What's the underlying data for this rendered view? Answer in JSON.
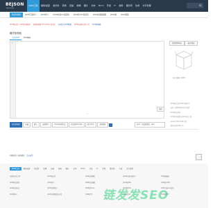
{
  "brand": {
    "name": "BEJSON",
    "tagline": "bejson.com"
  },
  "nav": {
    "items": [
      "JSON工具",
      "编码/加密",
      "格式化",
      "转换",
      "压缩",
      "前端",
      "图片",
      "文本",
      "Mock",
      "开发",
      "IT",
      "常用",
      "图片转",
      "生成",
      "文字处理"
    ],
    "active_index": 0
  },
  "tool_tabs": [
    "格式化校验",
    "JSON压缩转义",
    "JSON转义",
    "JSON在线uni组装格",
    "JSON转CSV格式化",
    "JSON在线图视图",
    "JSON格",
    "JSON模板"
  ],
  "tool_tabs_active": 0,
  "page_title": "格式化校验",
  "notices": [
    {
      "text": "JSON格式化 / JSON在线校验",
      "color": "red"
    },
    {
      "text": "使用快捷键 Ctrl+Enter 格式化",
      "color": "red"
    },
    {
      "text": "支持超大JSON数据",
      "color": "blue"
    },
    {
      "text": "JSON在线格式化工具",
      "color": "red"
    },
    {
      "text": "JSON编辑器",
      "color": "blue"
    }
  ],
  "sub_tabs": [
    "中文JSON",
    "JSON解析"
  ],
  "sub_tabs_active": 0,
  "editor": {
    "line_number": "1",
    "drag_hint": "≡",
    "save_label": "保存"
  },
  "side_buttons": [
    "复制代码地址",
    "展开/收起"
  ],
  "empty_text": "在左边输入JSON",
  "bullets": [
    "• JSON格式化/JSON压缩/转义",
    "• 支持一键JSON格式化与校验",
    "• JSON转实体类",
    "• JSON在线转换与JSON对比工具",
    "• JSON与XML/YAML互转",
    "• 更多在线JSON工具"
  ],
  "toolbar": {
    "buttons": [
      "格式化校验",
      "压缩",
      "转义",
      "去除转义",
      "Unicode转中文",
      "中文转Unicode",
      "转义引号",
      "字段排序"
    ],
    "primary_index": 0,
    "lang_select": "Java - 生成实体类 - Java"
  },
  "ask": {
    "prefix": "问题反馈 / 意见建议：",
    "link": "点击这里"
  },
  "footer": {
    "tabs": [
      "JSON工具",
      "编码加密",
      "格式化",
      "转换",
      "压缩",
      "前端",
      "图片",
      "文本",
      "Mock",
      "开发",
      "IT",
      "常用",
      "图片转",
      "生成",
      "文字处理"
    ],
    "active_index": 0,
    "links": [
      "在线格式化工具",
      "JSON格式化",
      "JSON在线解析",
      "JSON在线压缩转义",
      "JSON编辑器",
      "JSON转实体类",
      "JSON转义",
      "JSON在线视图",
      "JSON转XML",
      "JSON转YAML",
      "JSON在线对比",
      "JSON在线排序",
      "JSON转Excel",
      "JSON转CSV",
      "JSON生成Java实体",
      "JSON转Go",
      "JSON在线组装格式化",
      "JSON转TS",
      "JSON转C#",
      "JSON转PHP"
    ]
  },
  "watermark": "链发发SEO",
  "colors": {
    "topbar": "#2a3a4d",
    "accent": "#2f9bd9",
    "primary": "#2f6fb3",
    "watermark": "#2bd17d"
  }
}
